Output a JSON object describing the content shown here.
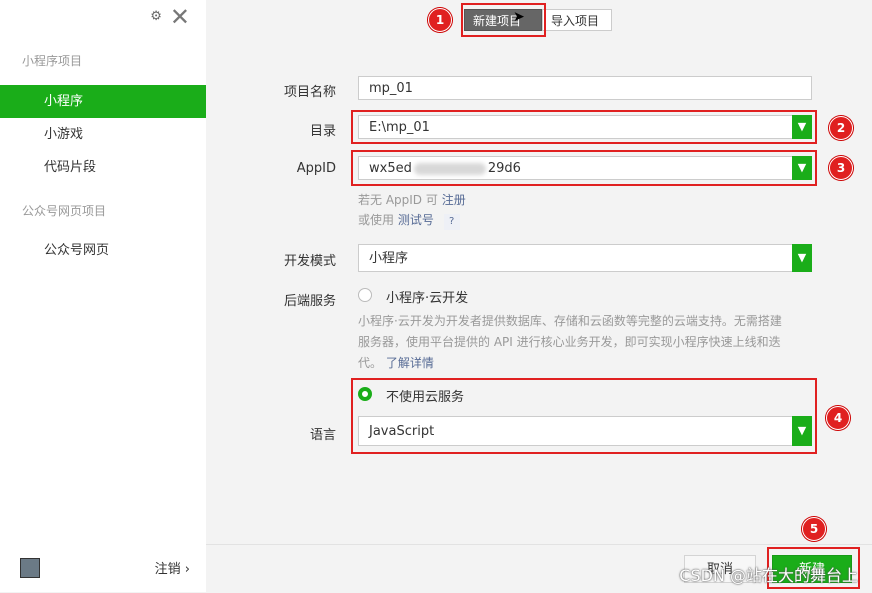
{
  "sidebar": {
    "group_mini": "小程序项目",
    "items": [
      {
        "label": "小程序"
      },
      {
        "label": "小游戏"
      },
      {
        "label": "代码片段"
      }
    ],
    "group_official": "公众号网页项目",
    "official_item": "公众号网页",
    "logout": "注销 ›"
  },
  "tabs": {
    "new_project": "新建项目",
    "import_project": "导入项目"
  },
  "form": {
    "name_label": "项目名称",
    "name_value": "mp_01",
    "dir_label": "目录",
    "dir_value": "E:\\mp_01",
    "appid_label": "AppID",
    "appid_prefix": "wx5ed",
    "appid_suffix": "29d6",
    "hint_no_appid": "若无 AppID 可",
    "hint_register": "注册",
    "hint_or_use": "或使用",
    "hint_test": "测试号",
    "hint_q": "?",
    "mode_label": "开发模式",
    "mode_value": "小程序",
    "backend_label": "后端服务",
    "cloud_option": "小程序·云开发",
    "cloud_desc_1": "小程序·云开发为开发者提供数据库、存储和云函数等完整的云端支持。无需搭建",
    "cloud_desc_2": "服务器，使用平台提供的 API 进行核心业务开发，即可实现小程序快速上线和迭",
    "cloud_desc_3": "代。",
    "learn_more": "了解详情",
    "no_cloud_option": "不使用云服务",
    "lang_label": "语言",
    "lang_value": "JavaScript"
  },
  "footer": {
    "cancel": "取消",
    "create": "新建"
  },
  "badges": [
    "1",
    "2",
    "3",
    "4",
    "5"
  ],
  "watermark": "CSDN @站在大的舞台上",
  "colors": {
    "accent": "#1aad19",
    "annotation": "#e02020",
    "link": "#576b95"
  }
}
